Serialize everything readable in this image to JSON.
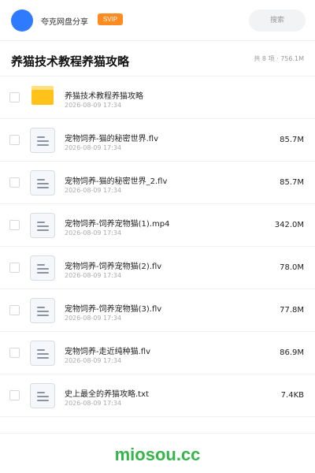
{
  "header": {
    "app_name": "夸克网盘分享",
    "badge": "SVIP",
    "search_placeholder": "搜索",
    "avatar_color": "#2f7bff",
    "badge_color": "#ff8a1f"
  },
  "title_bar": {
    "title": "养猫技术教程养猫攻略",
    "summary": "共 8 项 · 756.1M"
  },
  "files": [
    {
      "icon": "folder-icon",
      "name": "养猫技术教程养猫攻略",
      "date": "2026-08-09 17:34",
      "size": ""
    },
    {
      "icon": "file-icon",
      "name": "宠物饲养-猫的秘密世界.flv",
      "date": "2026-08-09 17:34",
      "size": "85.7M"
    },
    {
      "icon": "file-icon",
      "name": "宠物饲养-猫的秘密世界_2.flv",
      "date": "2026-08-09 17:34",
      "size": "85.7M"
    },
    {
      "icon": "file-icon",
      "name": "宠物饲养-饲养宠物猫(1).mp4",
      "date": "2026-08-09 17:34",
      "size": "342.0M"
    },
    {
      "icon": "file-icon",
      "name": "宠物饲养-饲养宠物猫(2).flv",
      "date": "2026-08-09 17:34",
      "size": "78.0M"
    },
    {
      "icon": "file-icon",
      "name": "宠物饲养-饲养宠物猫(3).flv",
      "date": "2026-08-09 17:34",
      "size": "77.8M"
    },
    {
      "icon": "file-icon",
      "name": "宠物饲养-走近纯种猫.flv",
      "date": "2026-08-09 17:34",
      "size": "86.9M"
    },
    {
      "icon": "file-icon",
      "name": "史上最全的养猫攻略.txt",
      "date": "2026-08-09 17:34",
      "size": "7.4KB"
    }
  ],
  "watermark": {
    "text": "miosou.cc",
    "color": "#35b54a"
  }
}
